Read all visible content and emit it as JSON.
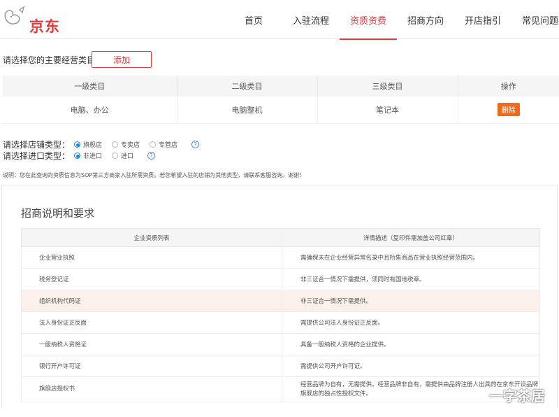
{
  "header": {
    "logo_text": "京东",
    "nav": [
      {
        "label": "首页",
        "active": false
      },
      {
        "label": "入驻流程",
        "active": false
      },
      {
        "label": "资质资费",
        "active": true
      },
      {
        "label": "招商方向",
        "active": false
      },
      {
        "label": "开店指引",
        "active": false
      },
      {
        "label": "常见问题",
        "active": false
      }
    ]
  },
  "category": {
    "prompt": "请选择您的主要经营类目：",
    "add_label": "添加",
    "columns": [
      "一级类目",
      "二级类目",
      "三级类目",
      "操作"
    ],
    "row": {
      "level1": "电脑、办公",
      "level2": "电脑整机",
      "level3": "笔记本",
      "action": "删除"
    }
  },
  "store_type": {
    "label": "请选择店铺类型：",
    "options": [
      "旗舰店",
      "专卖店",
      "专营店"
    ],
    "selected": "旗舰店"
  },
  "import_type": {
    "label": "请选择进口类型：",
    "options": [
      "非进口",
      "进口"
    ],
    "selected": "非进口"
  },
  "help_symbol": "?",
  "note": "说明：您在此查询的资质信息为SOP第三方商家入驻所需资质。若您希望入驻的店铺为其他类型，请联系客服咨询。谢谢！",
  "requirements": {
    "title": "招商说明和要求",
    "columns": [
      "企业资质列表",
      "详情描述（复印件需加盖公司红章）"
    ],
    "rows": [
      {
        "name": "企业营业执照",
        "desc": "需确保未在企业经营异常名录中且所售商品在营业执照经营范围内。"
      },
      {
        "name": "税务登记证",
        "desc": "非三证合一情况下需提供，须同时有国地税章。"
      },
      {
        "name": "组织机构代码证",
        "desc": "非三证合一情况下需提供。"
      },
      {
        "name": "法人身份证正反面",
        "desc": "需提供公司法人身份证正反面。"
      },
      {
        "name": "一般纳税人资格证",
        "desc": "具备一般纳税人资格的企业提供。"
      },
      {
        "name": "银行开户许可证",
        "desc": "需提供公司开户许可证。"
      },
      {
        "name": "旗舰店授权书",
        "desc": "经营品牌为自有，无需提供。经营品牌非自有，需提供由品牌注册人出具的在京东开设品牌旗舰店的独占性授权文件。"
      }
    ]
  },
  "watermark": "一字茶居",
  "colors": {
    "brand": "#e4393c",
    "delete": "#f06a1c",
    "radio": "#1e88e5"
  }
}
